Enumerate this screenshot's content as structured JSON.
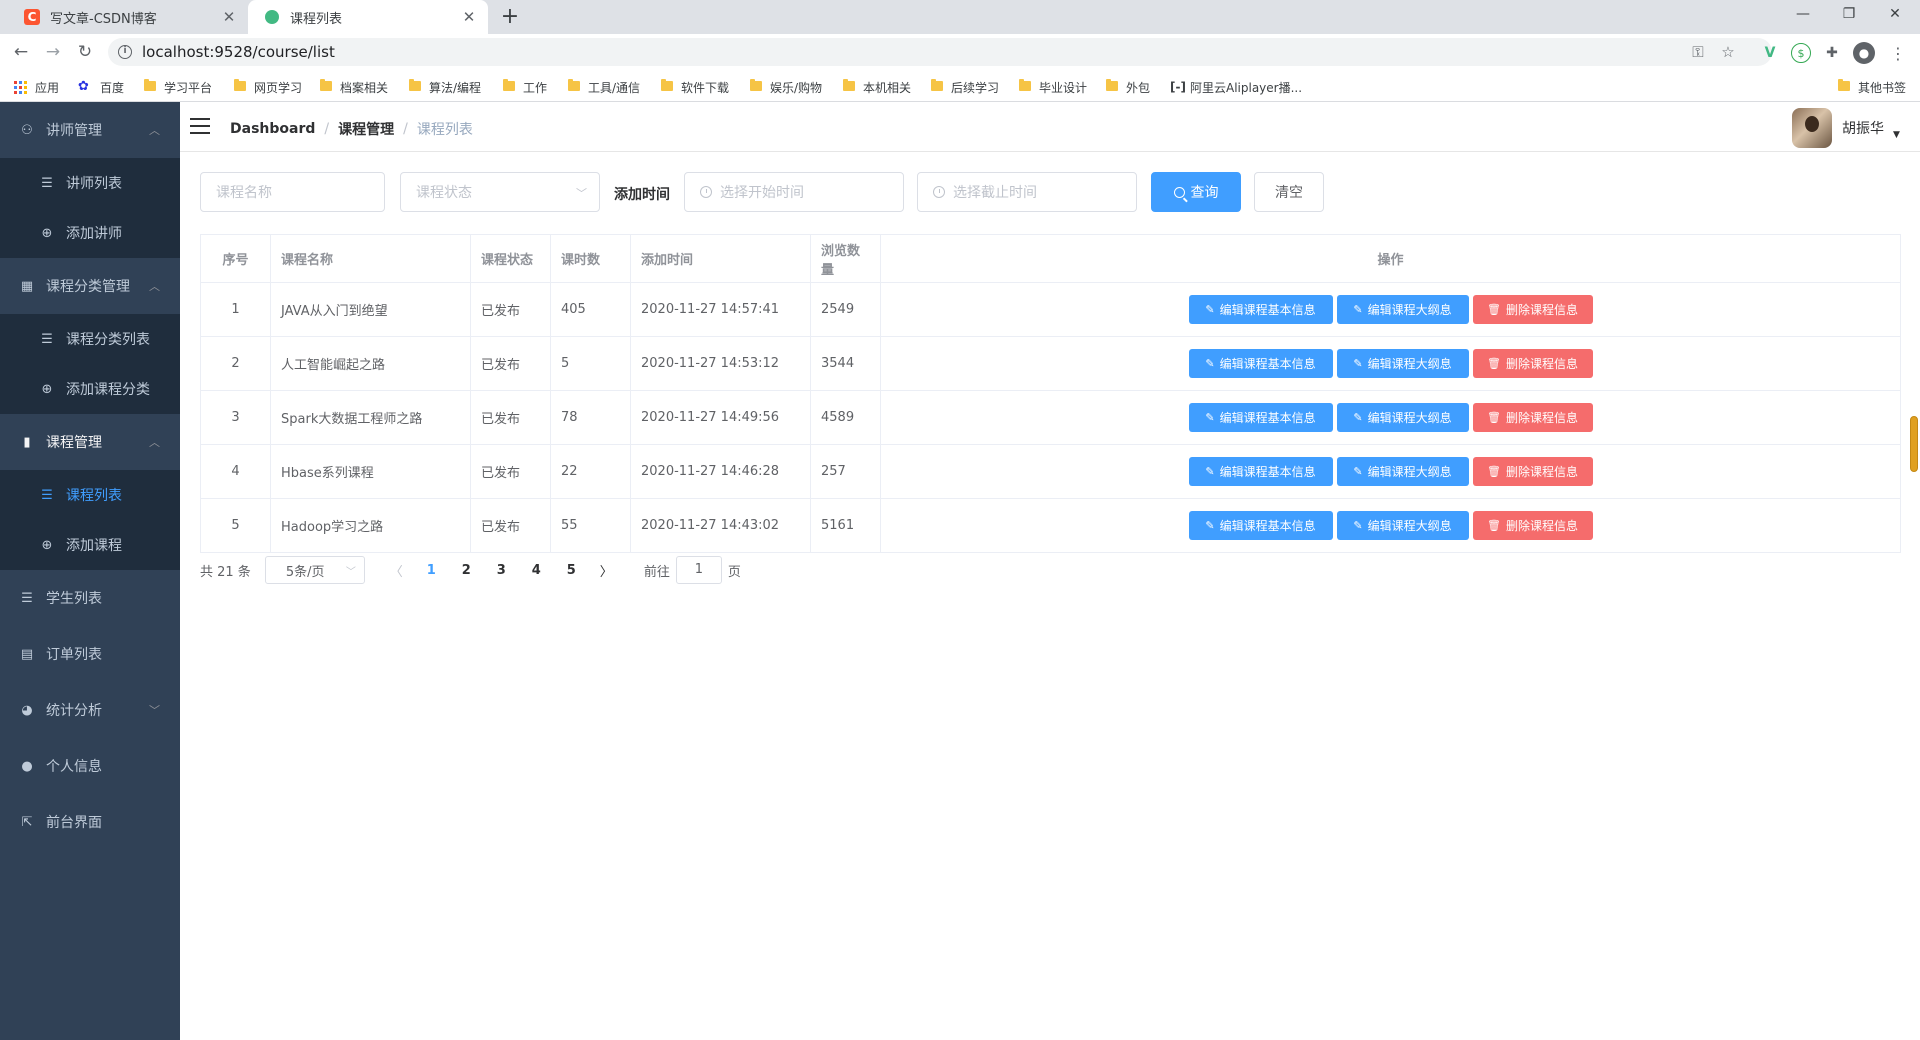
{
  "browser": {
    "tabs": [
      {
        "title": "写文章-CSDN博客",
        "favicon": "csdn-icon"
      },
      {
        "title": "课程列表",
        "favicon": "vue-icon"
      }
    ],
    "url": "localhost:9528/course/list",
    "bookmarks": [
      {
        "label": "应用",
        "icon": "apps-icon"
      },
      {
        "label": "百度",
        "icon": "baidu-icon"
      },
      {
        "label": "学习平台",
        "icon": "folder-icon"
      },
      {
        "label": "网页学习",
        "icon": "folder-icon"
      },
      {
        "label": "档案相关",
        "icon": "folder-icon"
      },
      {
        "label": "算法/编程",
        "icon": "folder-icon"
      },
      {
        "label": "工作",
        "icon": "folder-icon"
      },
      {
        "label": "工具/通信",
        "icon": "folder-icon"
      },
      {
        "label": "软件下载",
        "icon": "folder-icon"
      },
      {
        "label": "娱乐/购物",
        "icon": "folder-icon"
      },
      {
        "label": "本机相关",
        "icon": "folder-icon"
      },
      {
        "label": "后续学习",
        "icon": "folder-icon"
      },
      {
        "label": "毕业设计",
        "icon": "folder-icon"
      },
      {
        "label": "外包",
        "icon": "folder-icon"
      },
      {
        "label": "阿里云Aliplayer播...",
        "icon": "aliyun-icon"
      }
    ],
    "other_bookmarks": "其他书签"
  },
  "sidebar": {
    "teacher": {
      "label": "讲师管理",
      "items": [
        "讲师列表",
        "添加讲师"
      ]
    },
    "category": {
      "label": "课程分类管理",
      "items": [
        "课程分类列表",
        "添加课程分类"
      ]
    },
    "course": {
      "label": "课程管理",
      "items": [
        "课程列表",
        "添加课程"
      ]
    },
    "students": "学生列表",
    "orders": "订单列表",
    "stats": "统计分析",
    "profile": "个人信息",
    "frontend": "前台界面"
  },
  "navbar": {
    "breadcrumb": [
      "Dashboard",
      "课程管理",
      "课程列表"
    ],
    "user_name": "胡振华"
  },
  "filter": {
    "name_placeholder": "课程名称",
    "status_placeholder": "课程状态",
    "time_label": "添加时间",
    "start_placeholder": "选择开始时间",
    "end_placeholder": "选择截止时间",
    "query_label": "查询",
    "clear_label": "清空"
  },
  "table": {
    "headers": [
      "序号",
      "课程名称",
      "课程状态",
      "课时数",
      "添加时间",
      "浏览数量",
      "操作"
    ],
    "rows": [
      {
        "idx": "1",
        "name": "JAVA从入门到绝望",
        "status": "已发布",
        "lessons": "405",
        "time": "2020-11-27 14:57:41",
        "views": "2549"
      },
      {
        "idx": "2",
        "name": "人工智能崛起之路",
        "status": "已发布",
        "lessons": "5",
        "time": "2020-11-27 14:53:12",
        "views": "3544"
      },
      {
        "idx": "3",
        "name": "Spark大数据工程师之路",
        "status": "已发布",
        "lessons": "78",
        "time": "2020-11-27 14:49:56",
        "views": "4589"
      },
      {
        "idx": "4",
        "name": "Hbase系列课程",
        "status": "已发布",
        "lessons": "22",
        "time": "2020-11-27 14:46:28",
        "views": "257"
      },
      {
        "idx": "5",
        "name": "Hadoop学习之路",
        "status": "已发布",
        "lessons": "55",
        "time": "2020-11-27 14:43:02",
        "views": "5161"
      }
    ],
    "actions": {
      "edit_info": "编辑课程基本信息",
      "edit_outline": "编辑课程大纲息",
      "delete": "删除课程信息"
    }
  },
  "pagination": {
    "total": "共 21 条",
    "page_size": "5条/页",
    "pages": [
      "1",
      "2",
      "3",
      "4",
      "5"
    ],
    "current": "1",
    "goto_prefix": "前往",
    "goto_value": "1",
    "goto_suffix": "页"
  },
  "colors": {
    "sidebar_bg": "#304156",
    "submenu_bg": "#1f2d3d",
    "primary": "#409eff",
    "danger": "#f56c6c"
  }
}
